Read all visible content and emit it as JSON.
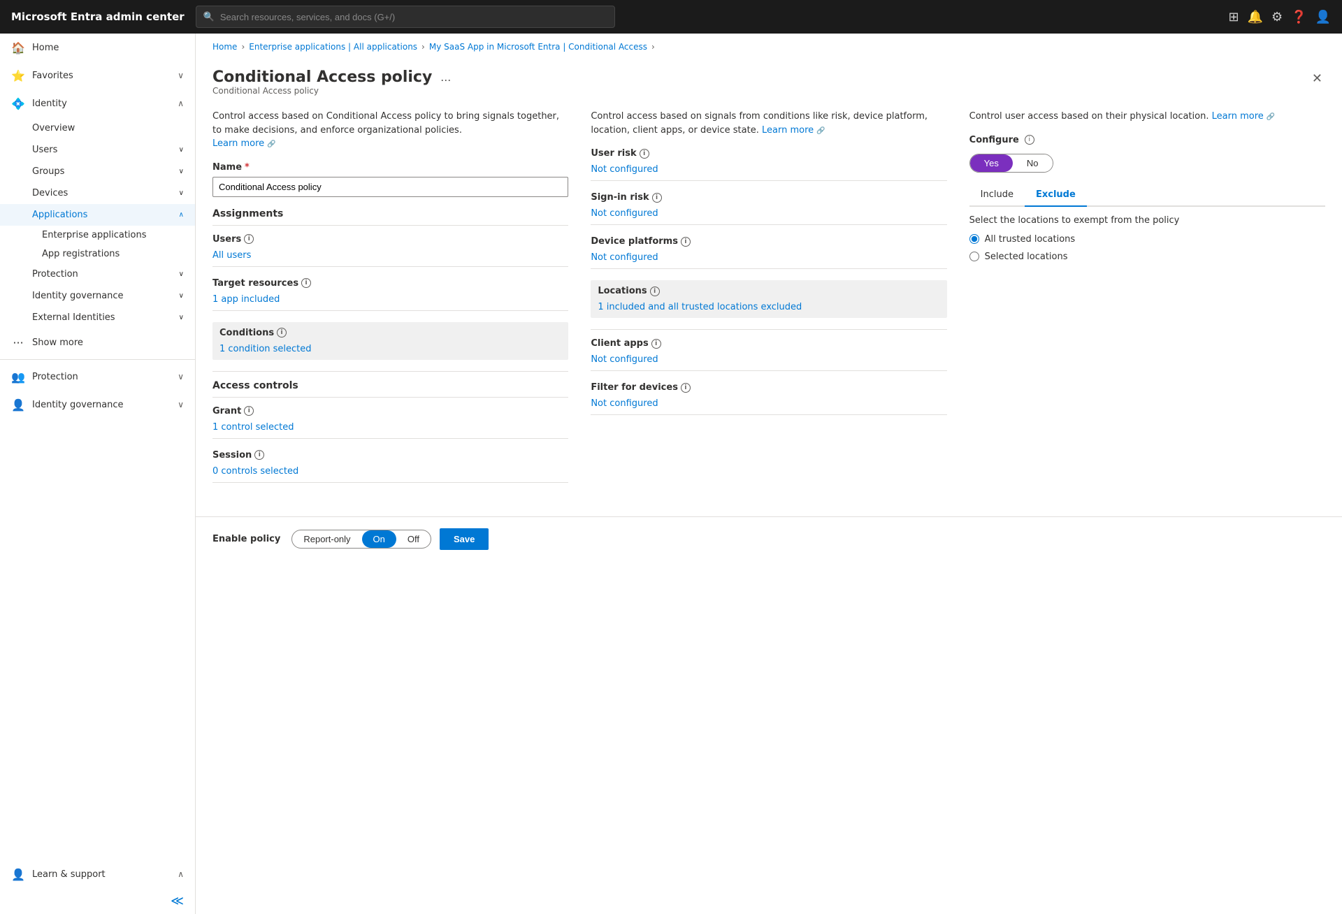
{
  "app": {
    "title": "Microsoft Entra admin center"
  },
  "search": {
    "placeholder": "Search resources, services, and docs (G+/)"
  },
  "breadcrumb": {
    "items": [
      "Home",
      "Enterprise applications | All applications",
      "My SaaS App in Microsoft Entra | Conditional Access"
    ]
  },
  "sidebar": {
    "home_label": "Home",
    "favorites_label": "Favorites",
    "identity_label": "Identity",
    "overview_label": "Overview",
    "users_label": "Users",
    "groups_label": "Groups",
    "devices_label": "Devices",
    "applications_label": "Applications",
    "enterprise_apps_label": "Enterprise applications",
    "app_registrations_label": "App registrations",
    "protection_label": "Protection",
    "identity_governance_label": "Identity governance",
    "external_identities_label": "External Identities",
    "show_more_label": "Show more",
    "protection2_label": "Protection",
    "identity_governance2_label": "Identity governance",
    "learn_support_label": "Learn & support"
  },
  "panel": {
    "title": "Conditional Access policy",
    "subtitle": "Conditional Access policy",
    "ellipsis": "...",
    "desc1": "Control access based on Conditional Access policy to bring signals together, to make decisions, and enforce organizational policies.",
    "learn_more1": "Learn more",
    "desc2": "Control access based on signals from conditions like risk, device platform, location, client apps, or device state.",
    "learn_more2": "Learn more",
    "desc3": "Control user access based on their physical location.",
    "learn_more3": "Learn more"
  },
  "form": {
    "name_label": "Name",
    "name_value": "Conditional Access policy",
    "assignments_label": "Assignments",
    "users_label": "Users",
    "users_value": "All users",
    "target_resources_label": "Target resources",
    "target_resources_value": "1 app included",
    "conditions_label": "Conditions",
    "conditions_value": "1 condition selected",
    "access_controls_label": "Access controls",
    "grant_label": "Grant",
    "grant_value": "1 control selected",
    "session_label": "Session",
    "session_value": "0 controls selected"
  },
  "conditions": {
    "user_risk_label": "User risk",
    "user_risk_value": "Not configured",
    "sign_in_risk_label": "Sign-in risk",
    "sign_in_risk_value": "Not configured",
    "device_platforms_label": "Device platforms",
    "device_platforms_value": "Not configured",
    "locations_label": "Locations",
    "locations_value": "1 included and all trusted locations excluded",
    "client_apps_label": "Client apps",
    "client_apps_value": "Not configured",
    "filter_devices_label": "Filter for devices",
    "filter_devices_value": "Not configured"
  },
  "locations_panel": {
    "configure_label": "Configure",
    "yes_label": "Yes",
    "no_label": "No",
    "include_tab": "Include",
    "exclude_tab": "Exclude",
    "exclude_desc": "Select the locations to exempt from the policy",
    "all_trusted_label": "All trusted locations",
    "selected_label": "Selected locations"
  },
  "enable_policy": {
    "label": "Enable policy",
    "report_only_label": "Report-only",
    "on_label": "On",
    "off_label": "Off",
    "save_label": "Save"
  }
}
